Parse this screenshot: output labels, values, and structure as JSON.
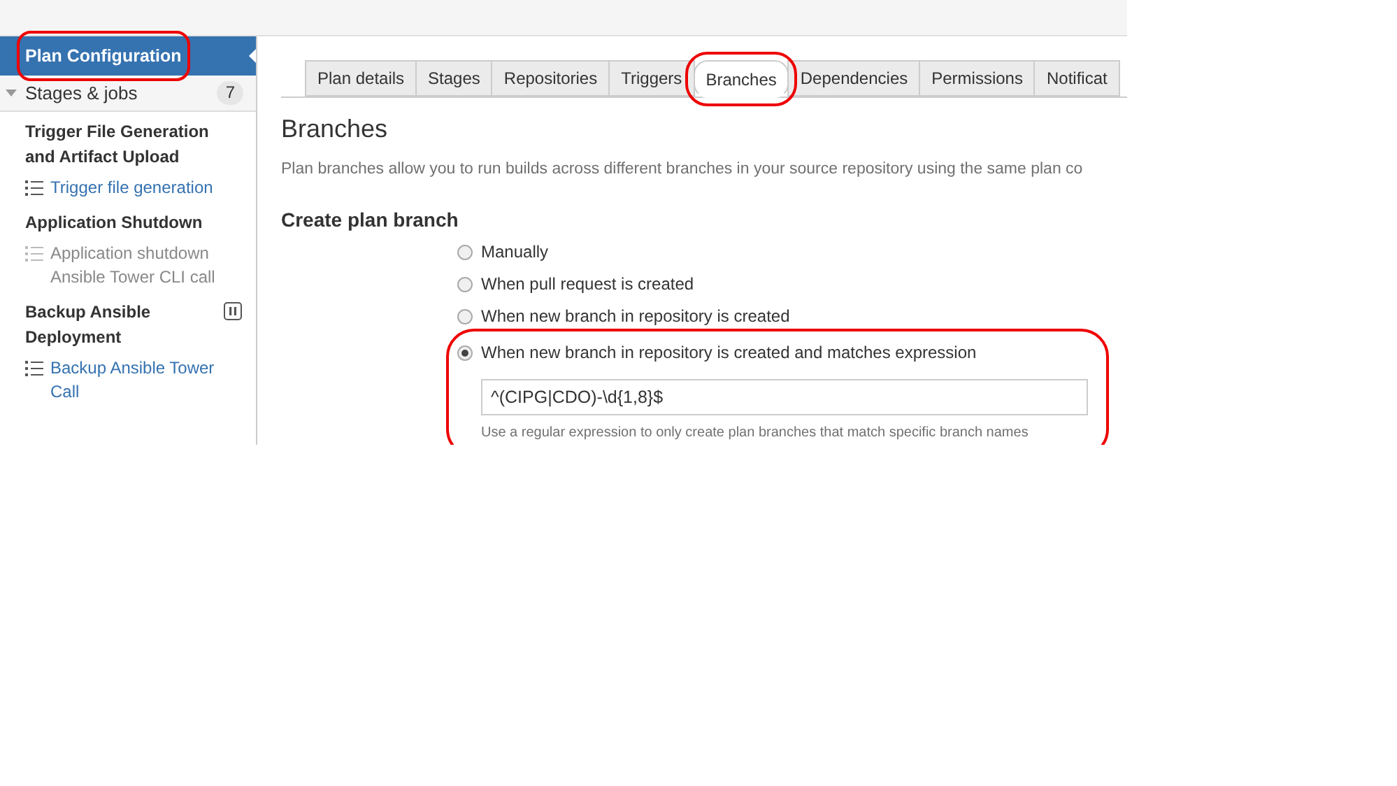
{
  "sidebar": {
    "header": {
      "label": "Plan Configuration",
      "selected": true,
      "highlighted": true
    },
    "stages_header": {
      "label": "Stages & jobs",
      "count": "7",
      "expanded": true
    },
    "stages": [
      {
        "name": "Trigger File Generation and Artifact Upload",
        "paused": false,
        "jobs": [
          {
            "label": "Trigger file generation",
            "disabled": false
          }
        ]
      },
      {
        "name": "Application Shutdown",
        "paused": false,
        "jobs": [
          {
            "label": "Application shutdown Ansible Tower CLI call",
            "disabled": true
          }
        ]
      },
      {
        "name": "Backup Ansible Deployment",
        "paused": true,
        "jobs": [
          {
            "label": "Backup Ansible Tower Call",
            "disabled": false
          }
        ]
      }
    ]
  },
  "tabs": [
    {
      "label": "Plan details",
      "selected": false,
      "highlighted": false
    },
    {
      "label": "Stages",
      "selected": false,
      "highlighted": false
    },
    {
      "label": "Repositories",
      "selected": false,
      "highlighted": false
    },
    {
      "label": "Triggers",
      "selected": false,
      "highlighted": false
    },
    {
      "label": "Branches",
      "selected": true,
      "highlighted": true
    },
    {
      "label": "Dependencies",
      "selected": false,
      "highlighted": false
    },
    {
      "label": "Permissions",
      "selected": false,
      "highlighted": false
    },
    {
      "label": "Notificat",
      "selected": false,
      "highlighted": false
    }
  ],
  "page": {
    "title": "Branches",
    "description": "Plan branches allow you to run builds across different branches in your source repository using the same plan co",
    "section_title": "Create plan branch",
    "options": [
      {
        "label": "Manually",
        "selected": false
      },
      {
        "label": "When pull request is created",
        "selected": false
      },
      {
        "label": "When new branch in repository is created",
        "selected": false
      },
      {
        "label": "When new branch in repository is created and matches expression",
        "selected": true,
        "highlighted": true,
        "field_value": "^(CIPG|CDO)-\\d{1,8}$",
        "help": "Use a regular expression to only create plan branches that match specific branch names"
      }
    ]
  }
}
